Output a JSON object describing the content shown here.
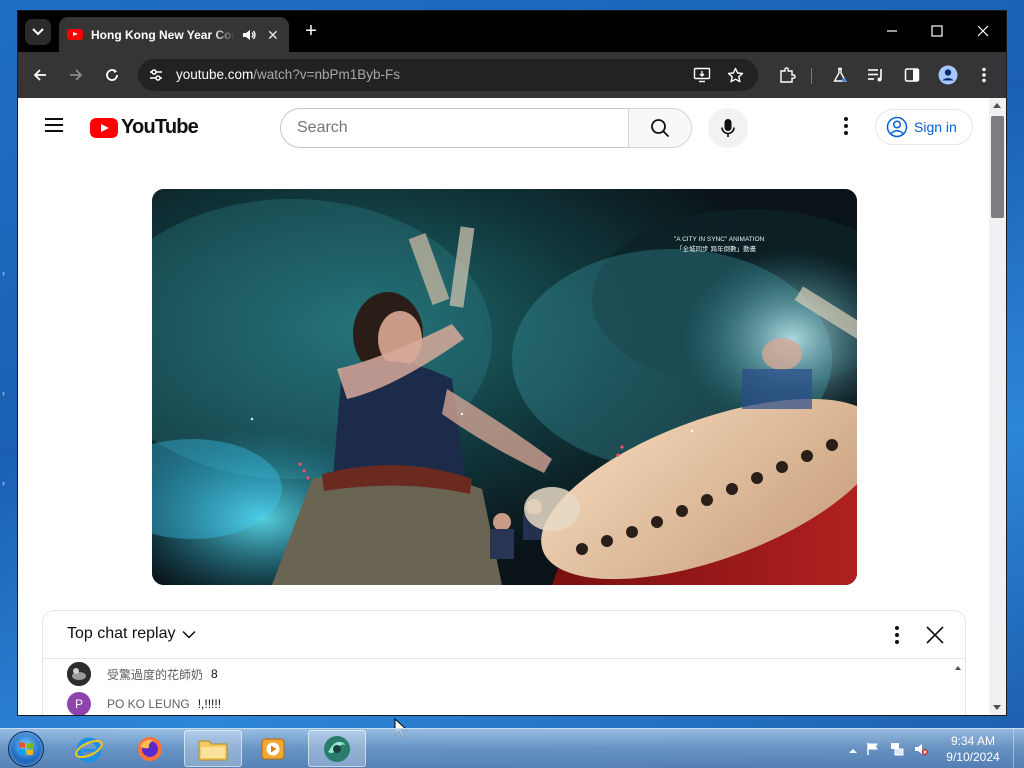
{
  "browser": {
    "tab": {
      "title": "Hong Kong New Year Countdown"
    },
    "url": {
      "host": "youtube.com",
      "path": "/watch?v=nbPm1Byb-Fs"
    }
  },
  "youtube": {
    "logo_text": "YouTube",
    "search": {
      "placeholder": "Search",
      "value": ""
    },
    "sign_in_label": "Sign in"
  },
  "video": {
    "overlay_line1": "\"A CITY IN SYNC\" ANIMATION",
    "overlay_line2": "「全城同步 跨年倒數」動畫"
  },
  "chat": {
    "title": "Top chat replay",
    "messages": [
      {
        "author": "受驚過度的花師奶",
        "text": "8",
        "avatar_letter": "",
        "avatar_color": "#3a3a3a"
      },
      {
        "author": "PO KO LEUNG",
        "text": "!,!!!!!",
        "avatar_letter": "P",
        "avatar_color": "#8e44ad"
      }
    ]
  },
  "taskbar": {
    "clock_time": "9:34 AM",
    "clock_date": "9/10/2024"
  },
  "colors": {
    "youtube_red": "#ff0000",
    "link_blue": "#065fd4",
    "browser_dark": "#353535"
  },
  "icons": [
    "tab-search-icon",
    "audio-icon",
    "close-icon",
    "new-tab-icon",
    "minimize-icon",
    "maximize-icon",
    "back-icon",
    "forward-icon",
    "reload-icon",
    "site-info-icon",
    "install-app-icon",
    "bookmark-star-icon",
    "extensions-icon",
    "labs-icon",
    "media-control-icon",
    "side-panel-icon",
    "profile-icon",
    "menu-icon",
    "hamburger-icon",
    "search-icon",
    "mic-icon",
    "more-icon",
    "account-icon",
    "chevron-down-icon",
    "windows-start-icon",
    "internet-explorer-icon",
    "firefox-icon",
    "file-explorer-icon",
    "media-player-icon",
    "app-icon",
    "flag-icon",
    "network-icon",
    "volume-muted-icon"
  ]
}
